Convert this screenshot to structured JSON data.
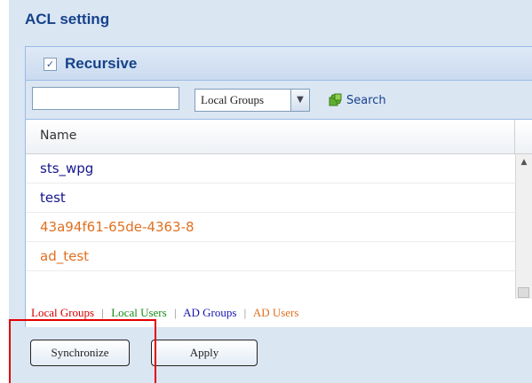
{
  "panel": {
    "title": "ACL setting"
  },
  "recursive": {
    "checked": true,
    "check_glyph": "✓",
    "label": "Recursive"
  },
  "toolbar": {
    "search_value": "",
    "filter_selected": "Local Groups",
    "dropdown_glyph": "▼",
    "search_label": "Search"
  },
  "table": {
    "column_header": "Name",
    "rows": [
      {
        "name": "sts_wpg",
        "kind": "local-group",
        "color": "#15158f"
      },
      {
        "name": "test",
        "kind": "local-group",
        "color": "#15158f"
      },
      {
        "name": "43a94f61-65de-4363-8",
        "kind": "ad-user",
        "color": "#e07020"
      },
      {
        "name": "ad_test",
        "kind": "ad-user",
        "color": "#e07020"
      }
    ]
  },
  "legend": [
    {
      "label": "Local Groups",
      "color": "#d40000"
    },
    {
      "label": "Local Users",
      "color": "#1a8a1a"
    },
    {
      "label": "AD Groups",
      "color": "#1515b0"
    },
    {
      "label": "AD Users",
      "color": "#e07020"
    }
  ],
  "legend_separator": "|",
  "footer": {
    "sync_label": "Synchronize",
    "apply_label": "Apply"
  },
  "colors": {
    "panel_bg": "#dbe6f3",
    "header_text": "#15428b",
    "highlight": "#e30000"
  }
}
